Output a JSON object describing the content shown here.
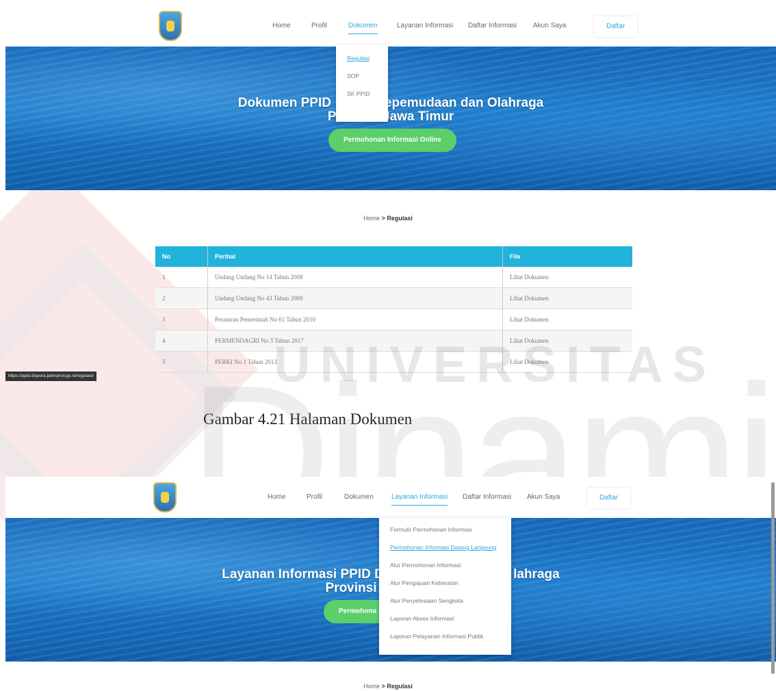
{
  "shot1": {
    "nav": [
      "Home",
      "Profil",
      "Dokumen",
      "Layanan Informasi",
      "Daftar Informasi",
      "Akun Saya"
    ],
    "daftar": "Daftar",
    "dropdown": [
      "Regulasi",
      "SOP",
      "SK PPID"
    ],
    "hero_left": "Dokumen PPID",
    "hero_right": "epemudaan dan Olahraga",
    "hero_line2": "Provinsi Jawa Timur",
    "cta": "Permohonan Informasi Online",
    "breadcrumb_home": "Home",
    "breadcrumb_current": "> Regulasi",
    "table": {
      "headers": [
        "No",
        "Perihal",
        "File"
      ],
      "rows": [
        [
          "1",
          "Undang Undang No 14 Tahun 2008",
          "Lihat Dokumen"
        ],
        [
          "2",
          "Undang Undang No 43 Tahun 2009",
          "Lihat Dokumen"
        ],
        [
          "3",
          "Peraturan Pemerintah No 61 Tahun 2010",
          "Lihat Dokumen"
        ],
        [
          "4",
          "PERMENDAGRI No 3 Tahun 2017",
          "Lihat Dokumen"
        ],
        [
          "5",
          "PERKI No 1 Tahun 2013",
          "Lihat Dokumen"
        ]
      ]
    },
    "url_tooltip": "https://ppid.dispora.jatimprov.go.id/regulasi/"
  },
  "caption": "Gambar 4.21 Halaman Dokumen",
  "watermark": {
    "top": "UNIVERSITAS",
    "bottom": "Dinamika"
  },
  "shot2": {
    "nav": [
      "Home",
      "Profil",
      "Dokumen",
      "Layanan Informasi",
      "Daftar Informasi",
      "Akun Saya"
    ],
    "daftar": "Daftar",
    "dropdown": [
      "Formulir Permohonan Informasi",
      "Permohonan Informasi Datang Langsung",
      "Alur Permohonan Informasi",
      "Alur Pengajuan Keberatan",
      "Alur Penyelesaian Sengketa",
      "Laporan Akses Informasi",
      "Laporan Pelayanan Informasi Publik"
    ],
    "hero_left": "Layanan Informasi PPID Di",
    "hero_right": "lahraga",
    "hero_line2": "Provinsi",
    "cta": "Permohona",
    "breadcrumb_home": "Home",
    "breadcrumb_current": "> Regulasi"
  },
  "colors": {
    "accent": "#2aa8d8",
    "table_header": "#22b3dc",
    "cta": "#5ccf6a"
  }
}
